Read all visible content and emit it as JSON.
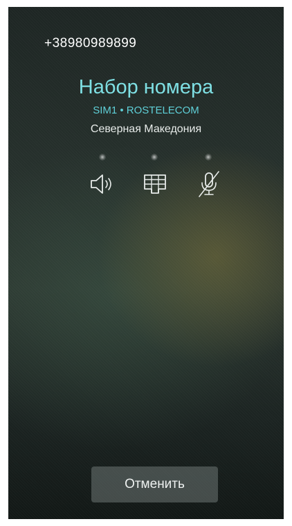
{
  "call": {
    "number": "+38980989899",
    "status": "Набор номера",
    "sim_info": "SIM1 • ROSTELECOM",
    "location": "Северная Македония"
  },
  "controls": [
    {
      "icon": "speaker-icon"
    },
    {
      "icon": "keypad-icon"
    },
    {
      "icon": "mute-microphone-icon"
    }
  ],
  "actions": {
    "cancel_label": "Отменить"
  },
  "colors": {
    "status_accent": "#7fe0e4",
    "sim_accent": "#5fd0d8",
    "text": "#ffffff",
    "background": "#26302c"
  }
}
